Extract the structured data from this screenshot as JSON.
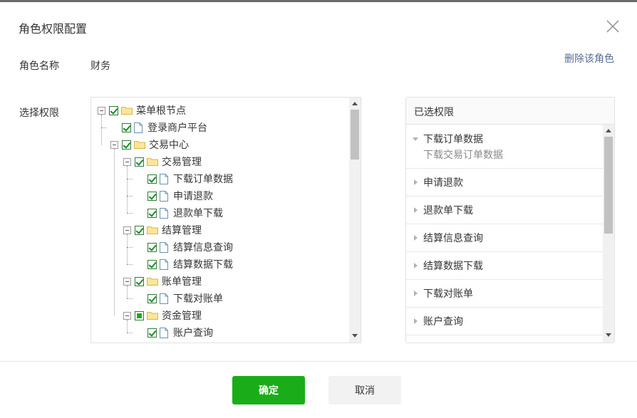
{
  "dialog": {
    "title": "角色权限配置",
    "close_icon": "close-icon"
  },
  "role": {
    "name_label": "角色名称",
    "name_value": "财务",
    "delete_link": "删除该角色"
  },
  "permissions": {
    "label": "选择权限",
    "tree": [
      {
        "label": "菜单根节点",
        "type": "folder",
        "level": 0,
        "expandable": true,
        "checked": true
      },
      {
        "label": "登录商户平台",
        "type": "doc",
        "level": 1,
        "expandable": false,
        "checked": true
      },
      {
        "label": "交易中心",
        "type": "folder",
        "level": 1,
        "expandable": true,
        "checked": true
      },
      {
        "label": "交易管理",
        "type": "folder",
        "level": 2,
        "expandable": true,
        "checked": true
      },
      {
        "label": "下载订单数据",
        "type": "doc",
        "level": 3,
        "expandable": false,
        "checked": true
      },
      {
        "label": "申请退款",
        "type": "doc",
        "level": 3,
        "expandable": false,
        "checked": true
      },
      {
        "label": "退款单下载",
        "type": "doc",
        "level": 3,
        "expandable": false,
        "checked": true
      },
      {
        "label": "结算管理",
        "type": "folder",
        "level": 2,
        "expandable": true,
        "checked": true
      },
      {
        "label": "结算信息查询",
        "type": "doc",
        "level": 3,
        "expandable": false,
        "checked": true
      },
      {
        "label": "结算数据下载",
        "type": "doc",
        "level": 3,
        "expandable": false,
        "checked": true
      },
      {
        "label": "账单管理",
        "type": "folder",
        "level": 2,
        "expandable": true,
        "checked": true
      },
      {
        "label": "下载对账单",
        "type": "doc",
        "level": 3,
        "expandable": false,
        "checked": true
      },
      {
        "label": "资金管理",
        "type": "folder",
        "level": 2,
        "expandable": true,
        "checked": "partial"
      },
      {
        "label": "账户查询",
        "type": "doc",
        "level": 3,
        "expandable": false,
        "checked": true
      }
    ],
    "tree_scroll_position": 0.0
  },
  "selected": {
    "header": "已选权限",
    "items": [
      {
        "label": "下载订单数据",
        "detail": "下载交易订单数据",
        "expanded": true
      },
      {
        "label": "申请退款",
        "expanded": false
      },
      {
        "label": "退款单下载",
        "expanded": false
      },
      {
        "label": "结算信息查询",
        "expanded": false
      },
      {
        "label": "结算数据下载",
        "expanded": false
      },
      {
        "label": "下载对账单",
        "expanded": false
      },
      {
        "label": "账户查询",
        "expanded": false
      }
    ]
  },
  "footer": {
    "confirm_label": "确定",
    "cancel_label": "取消"
  },
  "colors": {
    "primary": "#1aad19",
    "link": "#576b95",
    "check": "#1aad19"
  }
}
